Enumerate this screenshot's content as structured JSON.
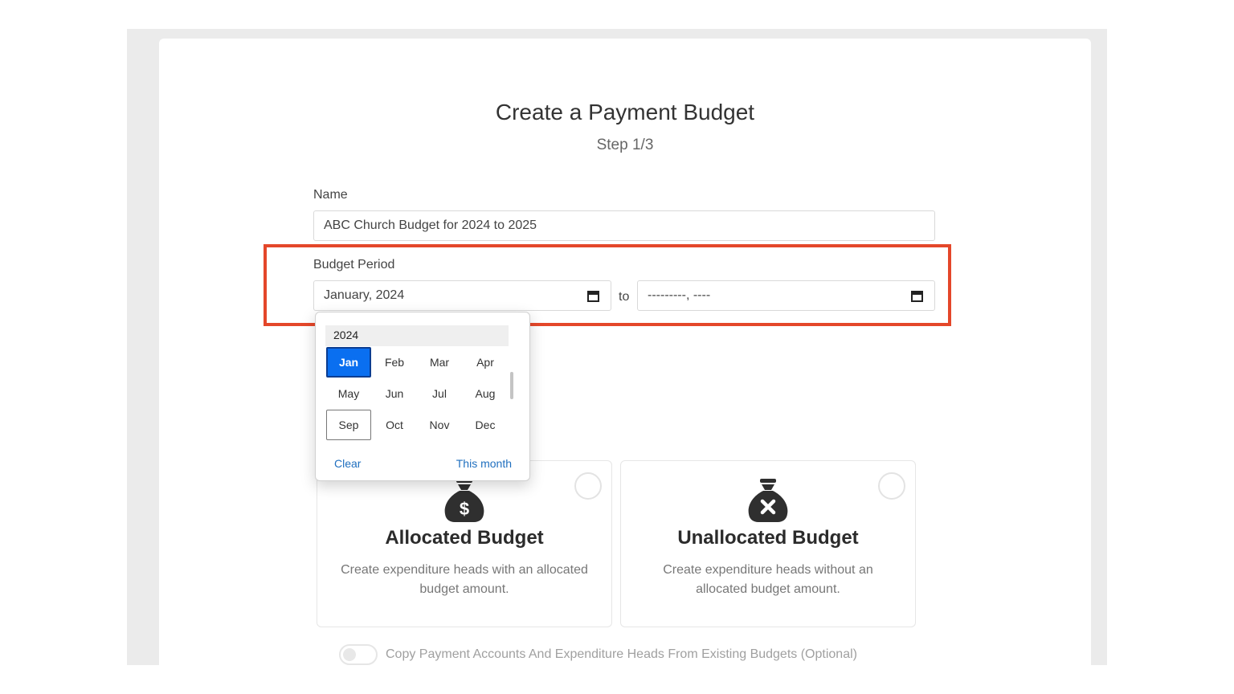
{
  "page": {
    "title": "Create a Payment Budget",
    "step": "Step 1/3"
  },
  "form": {
    "name_label": "Name",
    "name_value": "ABC Church Budget for 2024 to 2025",
    "period_label": "Budget Period",
    "period_from": "January, 2024",
    "to_label": "to",
    "period_to": "---------, ----"
  },
  "month_picker": {
    "year": "2024",
    "months": [
      "Jan",
      "Feb",
      "Mar",
      "Apr",
      "May",
      "Jun",
      "Jul",
      "Aug",
      "Sep",
      "Oct",
      "Nov",
      "Dec"
    ],
    "selected": "Jan",
    "current": "Sep",
    "clear_label": "Clear",
    "this_month_label": "This month"
  },
  "options": [
    {
      "icon": "money-bag-dollar-icon",
      "title": "Allocated Budget",
      "description": "Create expenditure heads with an allocated budget amount."
    },
    {
      "icon": "money-bag-x-icon",
      "title": "Unallocated Budget",
      "description": "Create expenditure heads without an allocated budget amount."
    }
  ],
  "copy_toggle": {
    "label": "Copy Payment Accounts And Expenditure Heads From Existing Budgets (Optional)",
    "checked": false
  },
  "colors": {
    "highlight": "#e4472a",
    "accent": "#0a6ff0",
    "link": "#1f6fbf"
  }
}
